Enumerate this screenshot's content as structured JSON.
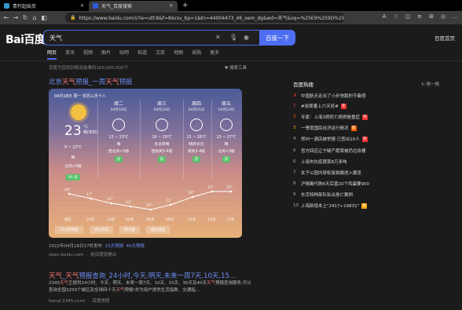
{
  "tabs": [
    {
      "label": "青柠起始页",
      "active": false,
      "color": "#39c"
    },
    {
      "label": "天气_百度搜索",
      "active": true,
      "color": "#2f5cde"
    }
  ],
  "url": "https://www.baidu.com/s?ie=utf-8&f=8&rsv_bp=1&tn=44004473_46_oem_dg&wd=天气&oq=%25E9%259D%25...",
  "logo": "Bai百度",
  "search": {
    "query": "天气",
    "button": "百度一下",
    "setting": "百度首页"
  },
  "navtabs": [
    "网页",
    "资讯",
    "视频",
    "图片",
    "贴吧",
    "知道",
    "文库",
    "地图",
    "采购",
    "更多"
  ],
  "meta": "百度为您找到相关结果约100,000,000个",
  "toolbtn": "搜索工具",
  "result1": {
    "title_pre": "北京",
    "title_hl": "天气",
    "title_mid": "预报_一周",
    "title_hl2": "天气",
    "title_post": "预报"
  },
  "weather": {
    "date": "04月18日 周一 农历三月十八",
    "temp": "23",
    "unit": "°C",
    "cond_now": "晴(实时)",
    "today": {
      "range": "9 ~ 23°C",
      "cond": "晴",
      "wind": "北风<3级",
      "aqi": "66 良"
    },
    "days": [
      {
        "name": "周二",
        "date": "04月19日",
        "range": "13 ~ 23°C",
        "cond": "晴",
        "wind": "西北风<3级",
        "aqi": "良"
      },
      {
        "name": "周三",
        "date": "04月20日",
        "range": "16 ~ 29°C",
        "cond": "多云转晴",
        "wind": "西南风3-4级",
        "aqi": "良"
      },
      {
        "name": "周四",
        "date": "04月21日",
        "range": "15 ~ 26°C",
        "cond": "晴转多云",
        "wind": "南风3-4级",
        "aqi": "良"
      },
      {
        "name": "周五",
        "date": "04月22日",
        "range": "13 ~ 27°C",
        "cond": "晴",
        "wind": "北风<3级",
        "aqi": "良"
      }
    ],
    "hours": [
      "现在",
      "20点",
      "23点",
      "02点",
      "05点",
      "08点",
      "11点",
      "14点",
      "17点"
    ],
    "hour_temps": [
      "20°",
      "17°",
      "14°",
      "12°",
      "10°",
      "13°",
      "18°",
      "22°",
      "22°"
    ],
    "buttons": [
      "24小时温度",
      "风力风向",
      "降水量",
      "相对湿度"
    ]
  },
  "result1_src": {
    "date": "2022年04月18日17时发布",
    "link1": "15天预报",
    "link2": "40天预报",
    "site": "open.baidu.com",
    "fb": "给百度提建议"
  },
  "result2": {
    "t1": "天气",
    "t2": "_",
    "t3": "天气",
    "t4": "预报查询_24小时,今天,明天,未来一周7天,10天,15..."
  },
  "result2_body": {
    "p1": "2345",
    "hl1": "天气",
    "p2": "王提供24小时、今天、明天、未来一周7天、10天、15天、30天及40天",
    "hl2": "天气",
    "p3": "预报查询服务,可以查询全国3259个城区及全球四十天",
    "hl3": "天气",
    "p4": "预报!并为用户提供生活指数、交通指..."
  },
  "result2_src": {
    "site": "tianqi.2345.com/",
    "snap": "百度快照"
  },
  "hotlist": {
    "title": "百度热搜",
    "change": "换一换",
    "items": [
      {
        "n": "",
        "text": "中国航天走出了小步快跑的节奏感",
        "tag": "",
        "tc": ""
      },
      {
        "n": "1",
        "text": "#说周董上六天班#",
        "tag": "热",
        "tc": "#f73131"
      },
      {
        "n": "2",
        "text": "专家：上海3例死亡病例是重症",
        "tag": "热",
        "tc": "#f73131"
      },
      {
        "n": "3",
        "text": "一季度国民经济运行情况",
        "tag": "新",
        "tc": "#ff6600"
      },
      {
        "n": "4",
        "text": "郑州一酒店被举报 已查出10人",
        "tag": "热",
        "tc": "#f73131"
      },
      {
        "n": "5",
        "text": "官方回应辽宁疑产蔬菜被扔垃圾桶",
        "tag": "",
        "tc": ""
      },
      {
        "n": "6",
        "text": "上海市抗疫蔬菜8万多吨",
        "tag": "",
        "tc": ""
      },
      {
        "n": "7",
        "text": "女子公园内穿松鼠拍摄进入展览",
        "tag": "",
        "tc": ""
      },
      {
        "n": "8",
        "text": "沪隔离代购6天后晋20个鸡蛋要900",
        "tag": "",
        "tc": ""
      },
      {
        "n": "9",
        "text": "东京特种部队私出身亡案例",
        "tag": "",
        "tc": ""
      },
      {
        "n": "10",
        "text": "上海新增本土\"2417+19831\"",
        "tag": "热",
        "tc": "#faa90e"
      }
    ]
  },
  "colors": {
    "accent": "#4e6ef2",
    "link": "#6d8cf2",
    "highlight": "#f37777"
  }
}
